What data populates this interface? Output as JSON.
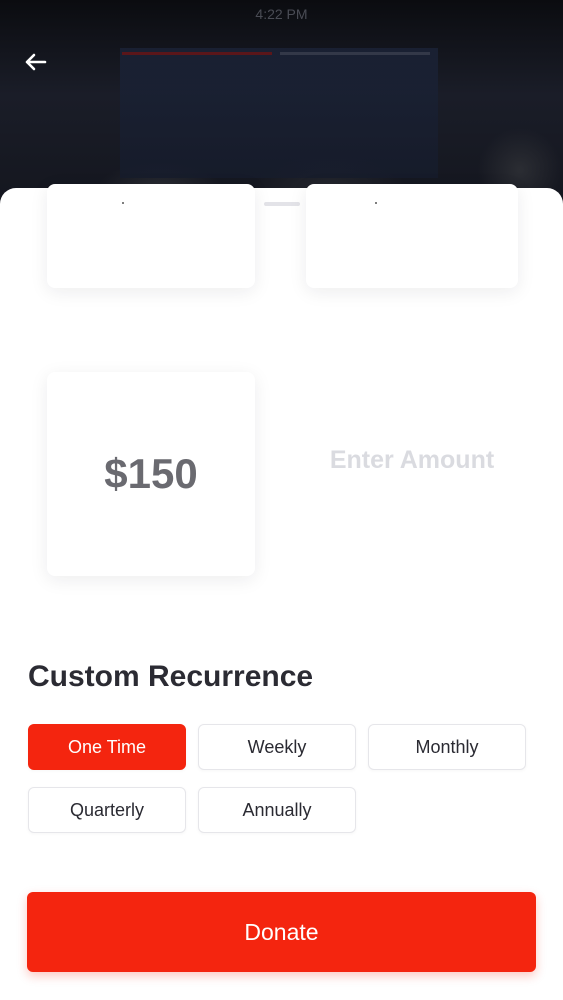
{
  "status_bar": {
    "time": "4:22 PM"
  },
  "header": {
    "back_icon": "arrow-left-icon"
  },
  "amounts": {
    "selected": "$150",
    "custom_placeholder": "Enter Amount"
  },
  "recurrence": {
    "title": "Custom Recurrence",
    "options": [
      "One Time",
      "Weekly",
      "Monthly",
      "Quarterly",
      "Annually"
    ],
    "selected": "One Time"
  },
  "donate_label": "Donate",
  "colors": {
    "accent": "#f4250f",
    "title_text": "#2b2b33",
    "amount_text": "#6a6a70",
    "placeholder_text": "#dadbe0"
  }
}
